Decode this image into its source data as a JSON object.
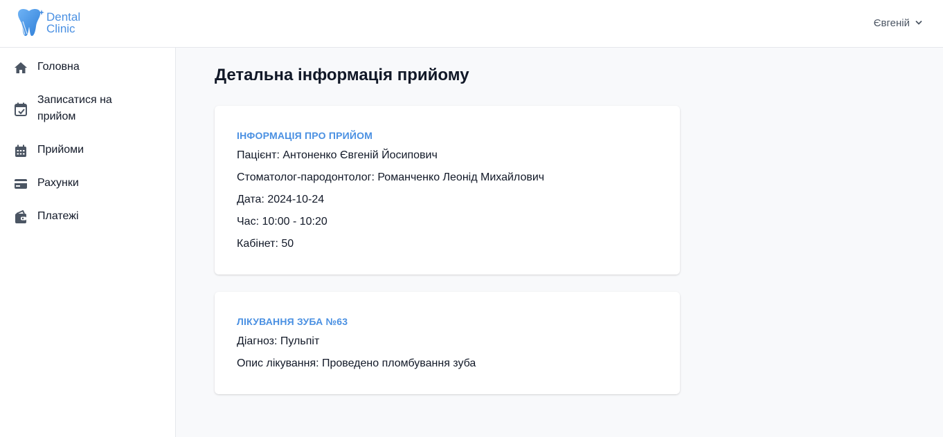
{
  "header": {
    "logo_line1": "Dental",
    "logo_line2": "Clinic",
    "user_name": "Євгеній",
    "brand_color": "#4a90e2"
  },
  "sidebar": {
    "items": [
      {
        "label": "Головна",
        "icon": "home-icon"
      },
      {
        "label": "Записатися на прийом",
        "icon": "calendar-add-icon"
      },
      {
        "label": "Прийоми",
        "icon": "calendar-icon"
      },
      {
        "label": "Рахунки",
        "icon": "credit-card-icon"
      },
      {
        "label": "Платежі",
        "icon": "wallet-icon"
      }
    ]
  },
  "main": {
    "title": "Детальна інформація прийому",
    "appointment_card": {
      "heading": "ІНФОРМАЦІЯ ПРО ПРИЙОМ",
      "patient": "Пацієнт: Антоненко Євгеній Йосипович",
      "doctor": "Стоматолог-пародонтолог: Романченко Леонід Михайлович",
      "date": "Дата: 2024-10-24",
      "time": "Час: 10:00 - 10:20",
      "room": "Кабінет: 50"
    },
    "treatment_card": {
      "heading": "ЛІКУВАННЯ ЗУБА №63",
      "diagnosis": "Діагноз: Пульпіт",
      "description": "Опис лікування: Проведено пломбування зуба"
    }
  }
}
